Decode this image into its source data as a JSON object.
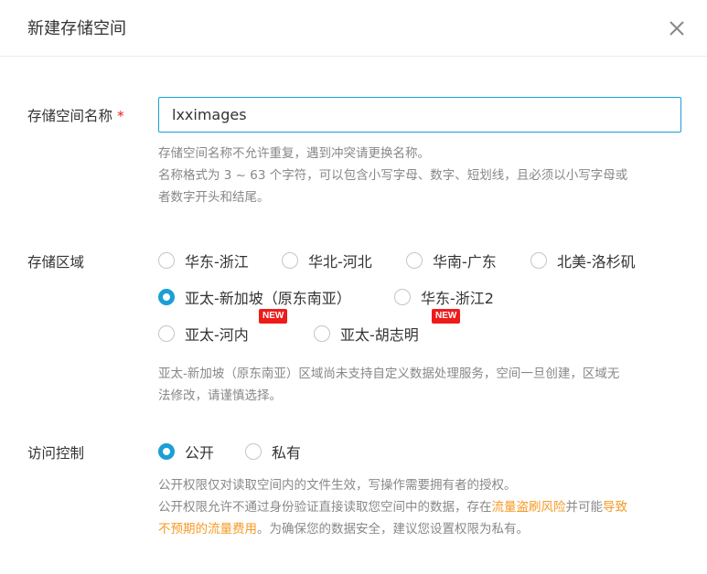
{
  "dialog": {
    "title": "新建存储空间"
  },
  "bucket_name": {
    "label": "存储空间名称",
    "required_mark": "*",
    "value": "lxximages",
    "help_line1": "存储空间名称不允许重复，遇到冲突请更换名称。",
    "help_line2": "名称格式为 3 ~ 63 个字符，可以包含小写字母、数字、短划线，且必须以小写字母或",
    "help_line3": "者数字开头和结尾。"
  },
  "region": {
    "label": "存储区域",
    "options": [
      {
        "label": "华东-浙江",
        "checked": false
      },
      {
        "label": "华北-河北",
        "checked": false
      },
      {
        "label": "华南-广东",
        "checked": false
      },
      {
        "label": "北美-洛杉矶",
        "checked": false
      },
      {
        "label": "亚太-新加坡（原东南亚）",
        "checked": true
      },
      {
        "label": "华东-浙江2",
        "checked": false
      },
      {
        "label": "亚太-河内",
        "checked": false,
        "badge": "NEW"
      },
      {
        "label": "亚太-胡志明",
        "checked": false,
        "badge": "NEW"
      }
    ],
    "help_line1": "亚太-新加坡（原东南亚）区域尚未支持自定义数据处理服务，空间一旦创建，区域无",
    "help_line2": "法修改，请谨慎选择。"
  },
  "access": {
    "label": "访问控制",
    "options": [
      {
        "label": "公开",
        "checked": true
      },
      {
        "label": "私有",
        "checked": false
      }
    ],
    "help_line1": "公开权限仅对读取空间内的文件生效，写操作需要拥有者的授权。",
    "help_line2_a": "公开权限允许不通过身份验证直接读取您空间中的数据，存在",
    "help_line2_link1": "流量盗刷风险",
    "help_line2_b": "并可能",
    "help_line2_link2a": "导致",
    "help_line3_link2b": "不预期的流量费用",
    "help_line3_c": "。为确保您的数据安全，建议您设置权限为私有。"
  },
  "colors": {
    "accent": "#1a9fd6",
    "warning": "#f59a23",
    "badge": "#ee1b1b"
  }
}
